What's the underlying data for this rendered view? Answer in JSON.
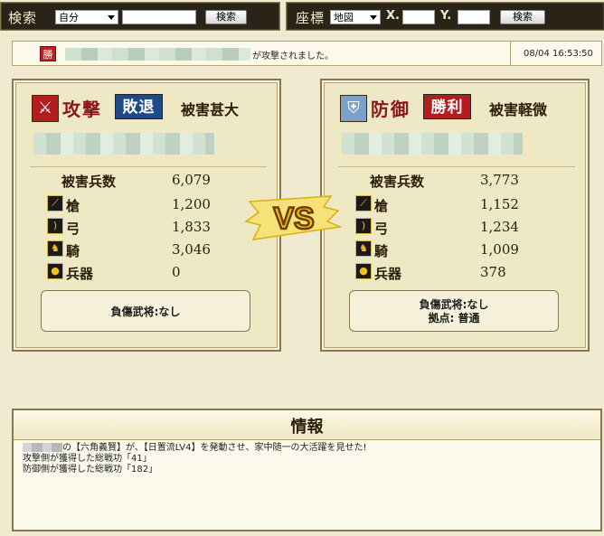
{
  "toolbar": {
    "search_label": "検索",
    "search_scope": "自分",
    "search_button": "検索",
    "coord_label": "座標",
    "coord_scope": "地図",
    "x_label": "X.",
    "y_label": "Y.",
    "coord_button": "検索"
  },
  "message": {
    "icon_label": "勝",
    "text": "が攻撃されました。",
    "timestamp": "08/04 16:53:50"
  },
  "attacker": {
    "side_label": "攻撃",
    "result": "敗退",
    "damage_level": "被害甚大",
    "total_label": "被害兵数",
    "total_value": "6,079",
    "units": [
      {
        "label": "槍",
        "icon": "spear-icon",
        "value": "1,200"
      },
      {
        "label": "弓",
        "icon": "bow-icon",
        "value": "1,833"
      },
      {
        "label": "騎",
        "icon": "horse-icon",
        "value": "3,046"
      },
      {
        "label": "兵器",
        "icon": "siege-icon",
        "value": "0"
      }
    ],
    "injured_generals": "負傷武将:なし"
  },
  "defender": {
    "side_label": "防御",
    "result": "勝利",
    "damage_level": "被害軽微",
    "total_label": "被害兵数",
    "total_value": "3,773",
    "units": [
      {
        "label": "槍",
        "icon": "spear-icon",
        "value": "1,152"
      },
      {
        "label": "弓",
        "icon": "bow-icon",
        "value": "1,234"
      },
      {
        "label": "騎",
        "icon": "horse-icon",
        "value": "1,009"
      },
      {
        "label": "兵器",
        "icon": "siege-icon",
        "value": "378"
      }
    ],
    "injured_generals": "負傷武将:なし",
    "base_status": "拠点: 普通"
  },
  "vs_label": "VS",
  "info": {
    "title": "情報",
    "lines": [
      "の【六角義賢】が、【日置流LV4】を発動させ、家中随一の大活躍を見せた!",
      "攻撃側が獲得した総戦功「41」",
      "防御側が獲得した総戦功「182」"
    ]
  },
  "colors": {
    "page_bg": "#f0ebd0",
    "attack_red": "#b31d1d",
    "defeat_blue": "#1f4a88",
    "vs_gold": "#f5d100"
  }
}
